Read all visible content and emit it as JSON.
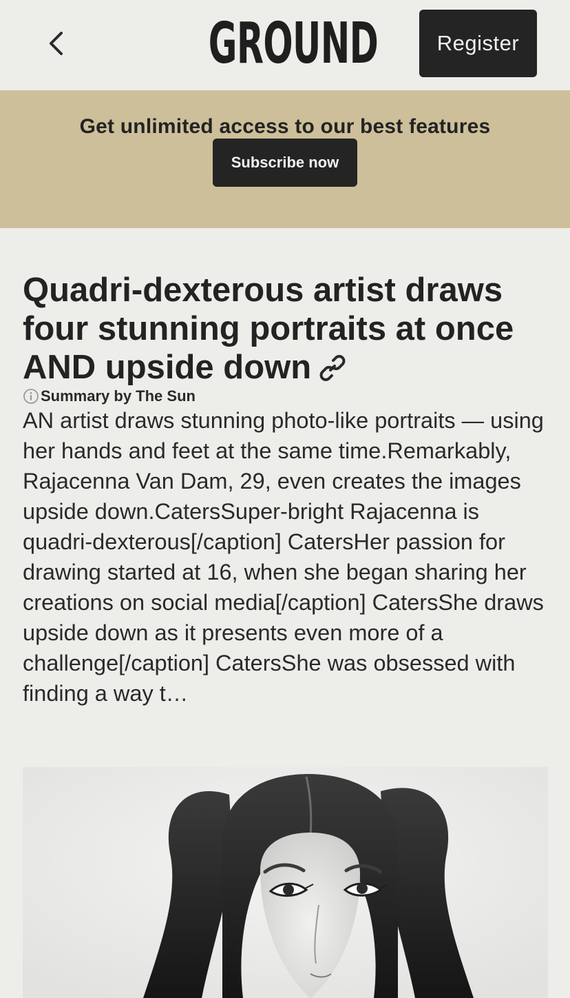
{
  "header": {
    "back_icon": "chevron-left-icon",
    "logo_text": "GROUND",
    "register_label": "Register"
  },
  "promo": {
    "text": "Get unlimited access to our best features",
    "subscribe_label": "Subscribe now"
  },
  "article": {
    "headline": "Quadri-dexterous artist draws four stunning portraits at once AND upside down",
    "link_icon": "link-icon",
    "summary_icon": "info-icon",
    "summary_label": "Summary by The Sun",
    "body": "AN artist draws stunning photo-like portraits — using her hands and feet at the same time.Remarkably, Rajacenna Van Dam, 29, even creates the images upside down.CatersSuper-bright Rajacenna is quadri-dexterous[/caption] CatersHer passion for drawing started at 16, when she began sharing her creations on social media[/caption] CatersShe draws upside down as it presents even more of a challenge[/caption] CatersShe was obsessed with finding a way t…",
    "image_subject": "pencil portrait drawing of a woman with pigtails"
  },
  "colors": {
    "page_bg": "#ededea",
    "banner_bg": "#cdbf9a",
    "button_bg": "#242424",
    "text": "#232323"
  }
}
